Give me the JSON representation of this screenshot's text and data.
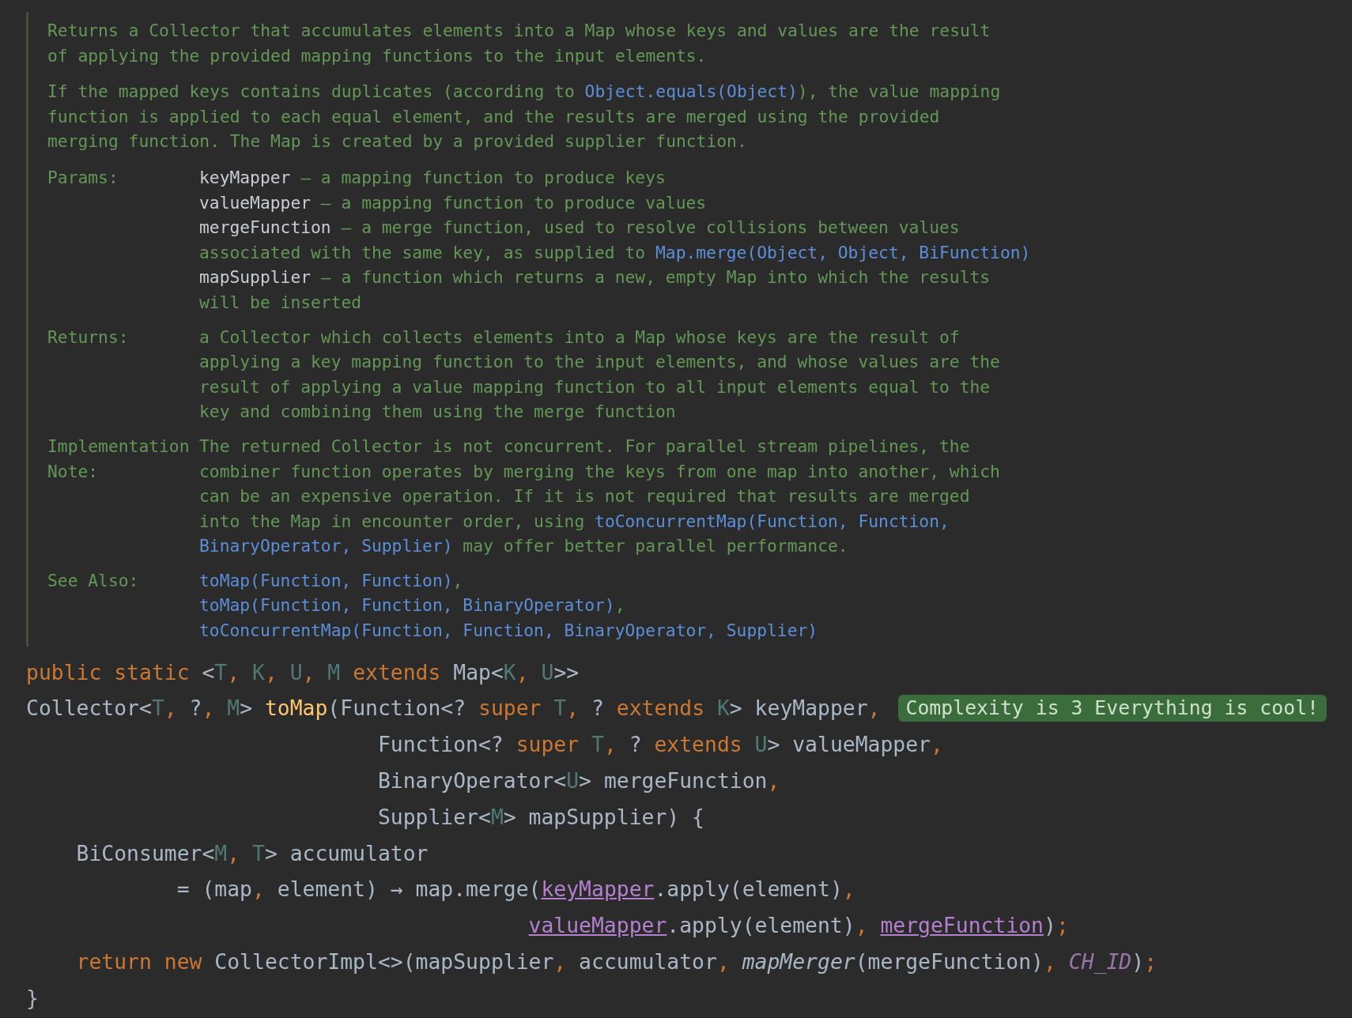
{
  "doc": {
    "paragraphs": [
      {
        "lines": [
          [
            {
              "kind": "text",
              "text": "Returns a Collector that accumulates elements into a Map whose keys and values are the result"
            }
          ],
          [
            {
              "kind": "text",
              "text": "of applying the provided mapping functions to the input elements."
            }
          ]
        ]
      },
      {
        "lines": [
          [
            {
              "kind": "text",
              "text": "If the mapped keys contains duplicates (according to "
            },
            {
              "kind": "link",
              "text": "Object.equals(Object)"
            },
            {
              "kind": "text",
              "text": "), the value mapping"
            }
          ],
          [
            {
              "kind": "text",
              "text": "function is applied to each equal element, and the results are merged using the provided"
            }
          ],
          [
            {
              "kind": "text",
              "text": "merging function. The Map is created by a provided supplier function."
            }
          ]
        ]
      }
    ],
    "sections": [
      {
        "label": "Params:",
        "entries": [
          {
            "lines": [
              [
                {
                  "kind": "param",
                  "text": "keyMapper"
                },
                {
                  "kind": "text",
                  "text": " – a mapping function to produce keys"
                }
              ]
            ]
          },
          {
            "lines": [
              [
                {
                  "kind": "param",
                  "text": "valueMapper"
                },
                {
                  "kind": "text",
                  "text": " – a mapping function to produce values"
                }
              ]
            ]
          },
          {
            "lines": [
              [
                {
                  "kind": "param",
                  "text": "mergeFunction"
                },
                {
                  "kind": "text",
                  "text": " – a merge function, used to resolve collisions between values"
                }
              ],
              [
                {
                  "kind": "text",
                  "text": "associated with the same key, as supplied to "
                },
                {
                  "kind": "link",
                  "text": "Map.merge(Object, Object, BiFunction)"
                }
              ]
            ]
          },
          {
            "lines": [
              [
                {
                  "kind": "param",
                  "text": "mapSupplier"
                },
                {
                  "kind": "text",
                  "text": " – a function which returns a new, empty Map into which the results"
                }
              ],
              [
                {
                  "kind": "text",
                  "text": "will be inserted"
                }
              ]
            ]
          }
        ]
      },
      {
        "label": "Returns:",
        "entries": [
          {
            "lines": [
              [
                {
                  "kind": "text",
                  "text": "a Collector which collects elements into a Map whose keys are the result of"
                }
              ],
              [
                {
                  "kind": "text",
                  "text": "applying a key mapping function to the input elements, and whose values are the"
                }
              ],
              [
                {
                  "kind": "text",
                  "text": "result of applying a value mapping function to all input elements equal to the"
                }
              ],
              [
                {
                  "kind": "text",
                  "text": "key and combining them using the merge function"
                }
              ]
            ]
          }
        ]
      },
      {
        "label": "Implementation Note:",
        "entries": [
          {
            "lines": [
              [
                {
                  "kind": "text",
                  "text": "The returned Collector is not concurrent. For parallel stream pipelines, the"
                }
              ],
              [
                {
                  "kind": "text",
                  "text": "combiner function operates by merging the keys from one map into another, which"
                }
              ],
              [
                {
                  "kind": "text",
                  "text": "can be an expensive operation. If it is not required that results are merged"
                }
              ],
              [
                {
                  "kind": "text",
                  "text": "into the Map in encounter order, using "
                },
                {
                  "kind": "link",
                  "text": "toConcurrentMap(Function, Function,"
                }
              ],
              [
                {
                  "kind": "link",
                  "text": "BinaryOperator, Supplier)"
                },
                {
                  "kind": "text",
                  "text": " may offer better parallel performance."
                }
              ]
            ]
          }
        ]
      },
      {
        "label": "See Also:",
        "entries": [
          {
            "lines": [
              [
                {
                  "kind": "link",
                  "text": "toMap(Function, Function)"
                },
                {
                  "kind": "text",
                  "text": ","
                }
              ]
            ]
          },
          {
            "lines": [
              [
                {
                  "kind": "link",
                  "text": "toMap(Function, Function, BinaryOperator)"
                },
                {
                  "kind": "text",
                  "text": ","
                }
              ]
            ]
          },
          {
            "lines": [
              [
                {
                  "kind": "link",
                  "text": "toConcurrentMap(Function, Function, BinaryOperator, Supplier)"
                }
              ]
            ]
          }
        ]
      }
    ]
  },
  "code_lines": [
    {
      "tokens": [
        {
          "kind": "keyword",
          "text": "public static "
        },
        {
          "kind": "plain",
          "text": "<"
        },
        {
          "kind": "type-param",
          "text": "T"
        },
        {
          "kind": "keyword",
          "text": ", "
        },
        {
          "kind": "type-param",
          "text": "K"
        },
        {
          "kind": "keyword",
          "text": ", "
        },
        {
          "kind": "type-param",
          "text": "U"
        },
        {
          "kind": "keyword",
          "text": ", "
        },
        {
          "kind": "type-param",
          "text": "M "
        },
        {
          "kind": "keyword",
          "text": "extends "
        },
        {
          "kind": "plain",
          "text": "Map<"
        },
        {
          "kind": "type-param",
          "text": "K"
        },
        {
          "kind": "keyword",
          "text": ", "
        },
        {
          "kind": "type-param",
          "text": "U"
        },
        {
          "kind": "plain",
          "text": ">>"
        }
      ]
    },
    {
      "tokens": [
        {
          "kind": "plain",
          "text": "Collector<"
        },
        {
          "kind": "type-param",
          "text": "T"
        },
        {
          "kind": "keyword",
          "text": ", "
        },
        {
          "kind": "plain",
          "text": "?"
        },
        {
          "kind": "keyword",
          "text": ", "
        },
        {
          "kind": "type-param",
          "text": "M"
        },
        {
          "kind": "plain",
          "text": "> "
        },
        {
          "kind": "method",
          "text": "toMap"
        },
        {
          "kind": "plain",
          "text": "(Function<? "
        },
        {
          "kind": "keyword",
          "text": "super "
        },
        {
          "kind": "type-param",
          "text": "T"
        },
        {
          "kind": "keyword",
          "text": ", "
        },
        {
          "kind": "plain",
          "text": "? "
        },
        {
          "kind": "keyword",
          "text": "extends "
        },
        {
          "kind": "type-param",
          "text": "K"
        },
        {
          "kind": "plain",
          "text": "> keyMapper"
        },
        {
          "kind": "keyword",
          "text": ","
        }
      ],
      "hint": "Complexity is 3 Everything is cool!"
    },
    {
      "tokens": [
        {
          "kind": "plain",
          "text": "                            Function<? "
        },
        {
          "kind": "keyword",
          "text": "super "
        },
        {
          "kind": "type-param",
          "text": "T"
        },
        {
          "kind": "keyword",
          "text": ", "
        },
        {
          "kind": "plain",
          "text": "? "
        },
        {
          "kind": "keyword",
          "text": "extends "
        },
        {
          "kind": "type-param",
          "text": "U"
        },
        {
          "kind": "plain",
          "text": "> valueMapper"
        },
        {
          "kind": "keyword",
          "text": ","
        }
      ]
    },
    {
      "tokens": [
        {
          "kind": "plain",
          "text": "                            BinaryOperator<"
        },
        {
          "kind": "type-param",
          "text": "U"
        },
        {
          "kind": "plain",
          "text": "> mergeFunction"
        },
        {
          "kind": "keyword",
          "text": ","
        }
      ]
    },
    {
      "tokens": [
        {
          "kind": "plain",
          "text": "                            Supplier<"
        },
        {
          "kind": "type-param",
          "text": "M"
        },
        {
          "kind": "plain",
          "text": "> mapSupplier) {"
        }
      ]
    },
    {
      "tokens": [
        {
          "kind": "plain",
          "text": "    BiConsumer<"
        },
        {
          "kind": "type-param",
          "text": "M"
        },
        {
          "kind": "keyword",
          "text": ", "
        },
        {
          "kind": "type-param",
          "text": "T"
        },
        {
          "kind": "plain",
          "text": "> accumulator"
        }
      ]
    },
    {
      "tokens": [
        {
          "kind": "plain",
          "text": "            = (map"
        },
        {
          "kind": "keyword",
          "text": ", "
        },
        {
          "kind": "plain",
          "text": "element) → map.merge("
        },
        {
          "kind": "captured",
          "text": "keyMapper"
        },
        {
          "kind": "plain",
          "text": ".apply(element)"
        },
        {
          "kind": "keyword",
          "text": ","
        }
      ]
    },
    {
      "aligned": true,
      "tokens": [
        {
          "kind": "captured",
          "text": "valueMapper"
        },
        {
          "kind": "plain",
          "text": ".apply(element)"
        },
        {
          "kind": "keyword",
          "text": ", "
        },
        {
          "kind": "captured",
          "text": "mergeFunction"
        },
        {
          "kind": "plain",
          "text": ")"
        },
        {
          "kind": "keyword",
          "text": ";"
        }
      ]
    },
    {
      "tokens": [
        {
          "kind": "keyword",
          "text": "    return new "
        },
        {
          "kind": "plain",
          "text": "CollectorImpl<>(mapSupplier"
        },
        {
          "kind": "keyword",
          "text": ", "
        },
        {
          "kind": "plain",
          "text": "accumulator"
        },
        {
          "kind": "keyword",
          "text": ", "
        },
        {
          "kind": "static-call",
          "text": "mapMerger"
        },
        {
          "kind": "plain",
          "text": "(mergeFunction)"
        },
        {
          "kind": "keyword",
          "text": ", "
        },
        {
          "kind": "constant",
          "text": "CH_ID"
        },
        {
          "kind": "plain",
          "text": ")"
        },
        {
          "kind": "keyword",
          "text": ";"
        }
      ]
    },
    {
      "tokens": [
        {
          "kind": "plain",
          "text": "}"
        }
      ]
    }
  ]
}
